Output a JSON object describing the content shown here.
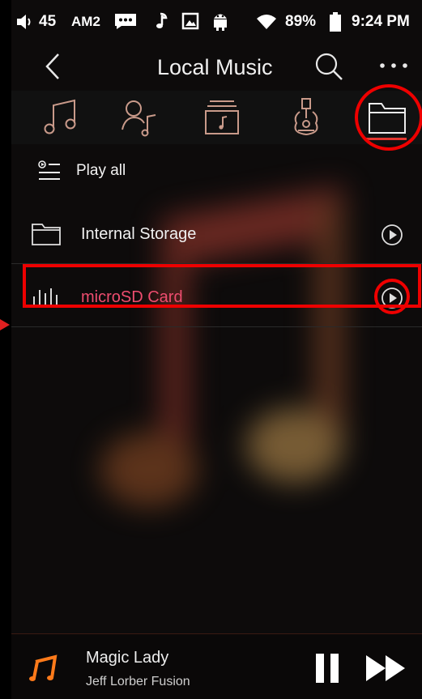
{
  "status": {
    "volume_level": "45",
    "mode": "AM2",
    "battery": "89%",
    "time": "9:24 PM"
  },
  "header": {
    "title": "Local Music",
    "back_icon": "back-arrow-icon",
    "search_icon": "search-icon",
    "more_icon": "more-dots-icon"
  },
  "tabs": [
    {
      "icon": "music-note-icon",
      "selected": false
    },
    {
      "icon": "artist-icon",
      "selected": false
    },
    {
      "icon": "album-icon",
      "selected": false
    },
    {
      "icon": "genre-guitar-icon",
      "selected": false
    },
    {
      "icon": "folder-icon",
      "selected": true
    }
  ],
  "play_all": {
    "label": "Play all"
  },
  "storage": [
    {
      "name": "Internal Storage",
      "icon": "folder-icon",
      "active": false
    },
    {
      "name": "microSD Card",
      "icon": "sd-card-icon",
      "active": true
    }
  ],
  "now_playing": {
    "title": "Magic Lady",
    "artist": "Jeff Lorber Fusion"
  },
  "colors": {
    "accent": "#e4372f",
    "active_text": "#ee4d6f",
    "annotation": "#e00000",
    "mini_icon": "#ff7a1a"
  }
}
